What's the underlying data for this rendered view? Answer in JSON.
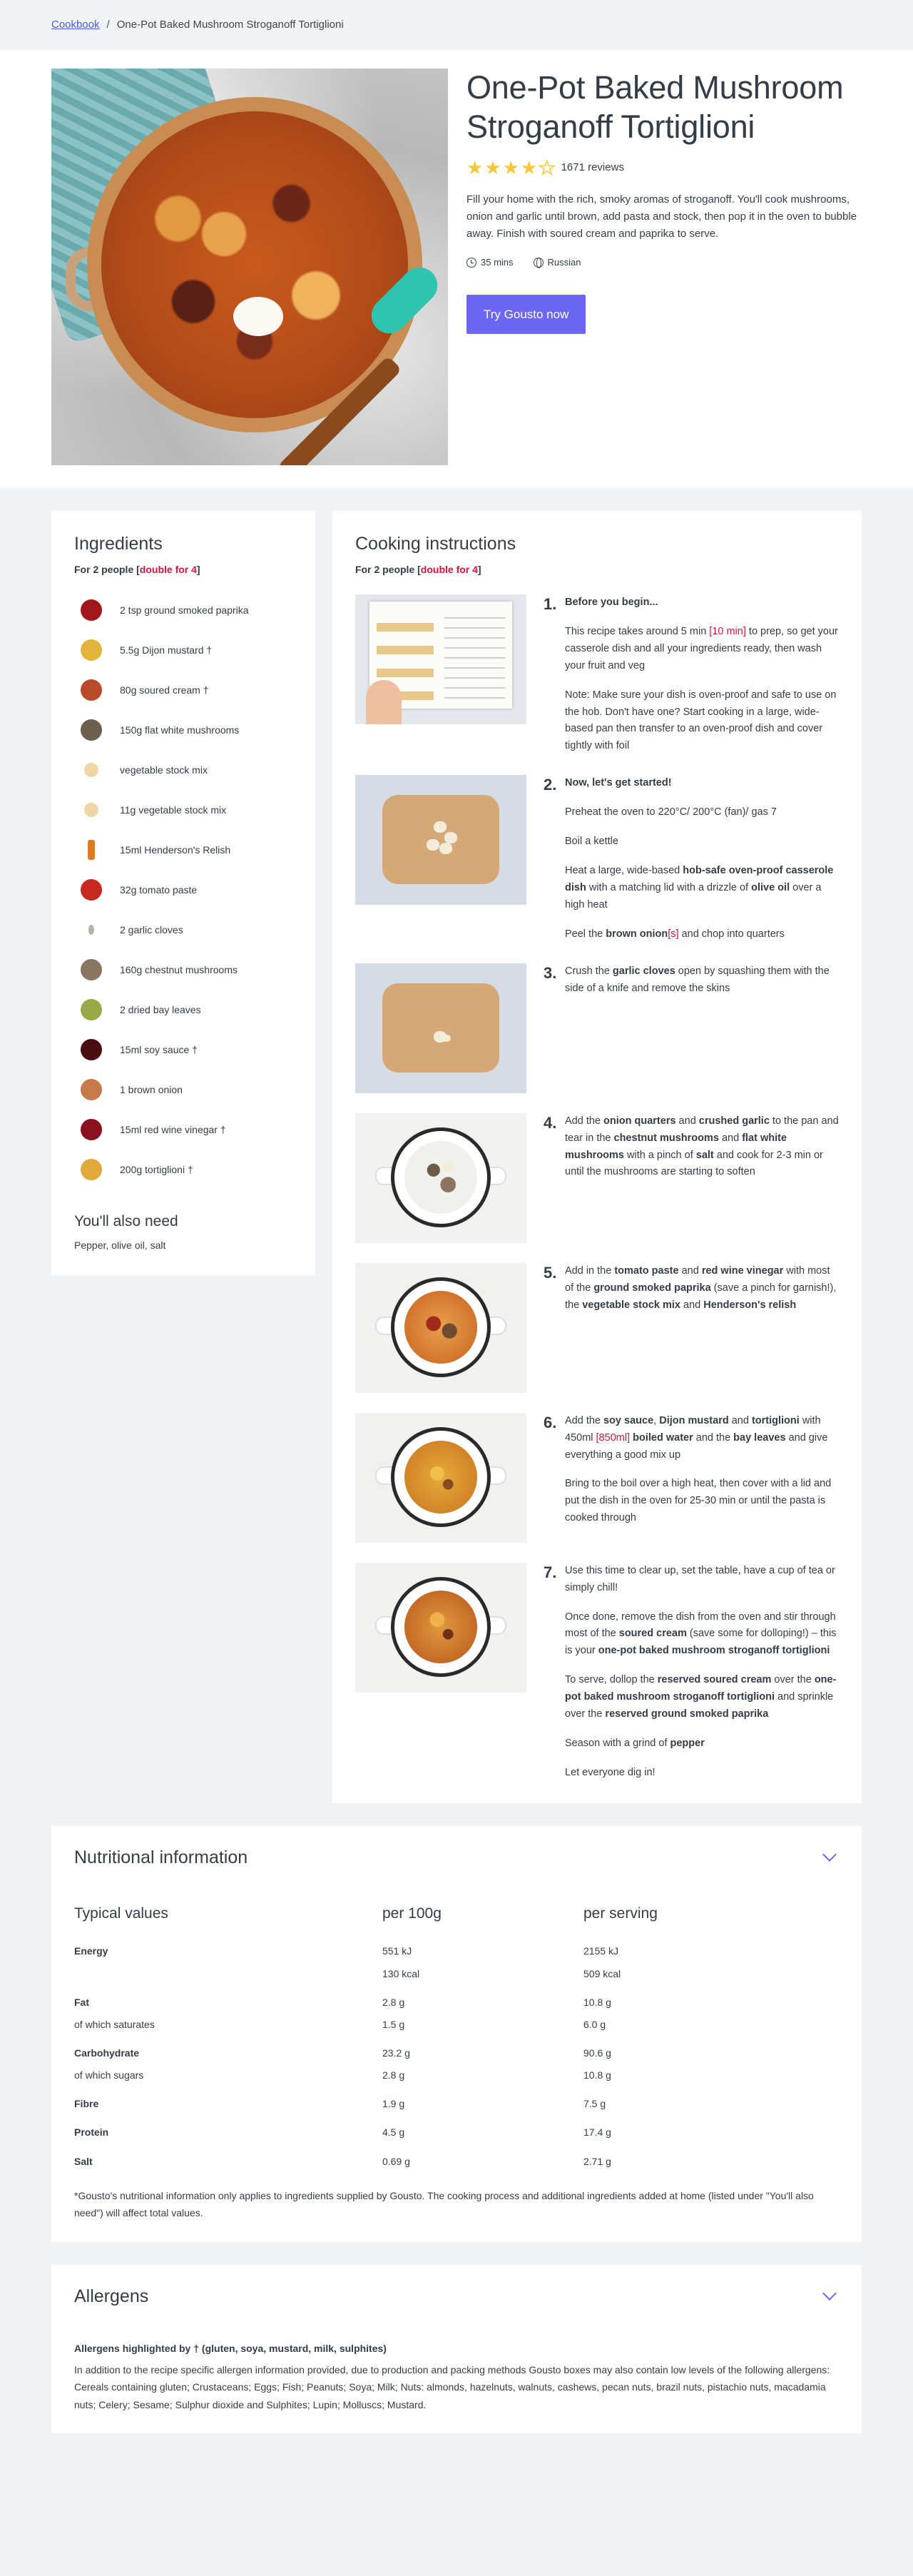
{
  "breadcrumb": {
    "root": "Cookbook",
    "separator": "/",
    "current": "One-Pot Baked Mushroom Stroganoff Tortiglioni"
  },
  "hero": {
    "title": "One-Pot Baked Mushroom Stroganoff Tortiglioni",
    "rating_stars": 4,
    "rating_max": 5,
    "review_count": "1671 reviews",
    "description": "Fill your home with the rich, smoky aromas of stroganoff. You'll cook mushrooms, onion and garlic until brown, add pasta and stock, then pop it in the oven to bubble away. Finish with soured cream and paprika to serve.",
    "time": "35 mins",
    "cuisine": "Russian",
    "cta_label": "Try Gousto now"
  },
  "ingredients": {
    "title": "Ingredients",
    "people_prefix": "For 2 people [",
    "people_link": "double for 4",
    "people_suffix": "]",
    "items": [
      {
        "label": "2 tsp ground smoked paprika",
        "icon": "paprika-icon",
        "color": "#a3171a"
      },
      {
        "label": "5.5g Dijon mustard †",
        "icon": "mustard-icon",
        "color": "#e2b43c"
      },
      {
        "label": "80g soured cream †",
        "icon": "soured-cream-icon",
        "color": "#b84a2a"
      },
      {
        "label": "150g flat white mushrooms",
        "icon": "mushroom-icon",
        "color": "#6e5e4e"
      },
      {
        "label": "vegetable stock mix",
        "icon": "stock-icon",
        "color": "#f2d7a6"
      },
      {
        "label": "11g vegetable stock mix",
        "icon": "stock-icon",
        "color": "#f2d7a6"
      },
      {
        "label": "15ml Henderson's Relish",
        "icon": "relish-bottle-icon",
        "color": "#e07a1c"
      },
      {
        "label": "32g tomato paste",
        "icon": "tomato-paste-icon",
        "color": "#c8281e"
      },
      {
        "label": "2 garlic cloves",
        "icon": "garlic-icon",
        "color": "#b8b0a0"
      },
      {
        "label": "160g chestnut mushrooms",
        "icon": "chestnut-mushroom-icon",
        "color": "#8a7462"
      },
      {
        "label": "2 dried bay leaves",
        "icon": "bay-leaf-icon",
        "color": "#9aa84a"
      },
      {
        "label": "15ml soy sauce †",
        "icon": "soy-sauce-icon",
        "color": "#4a0e10"
      },
      {
        "label": "1 brown onion",
        "icon": "onion-icon",
        "color": "#c87a4a"
      },
      {
        "label": "15ml red wine vinegar †",
        "icon": "vinegar-icon",
        "color": "#8a1020"
      },
      {
        "label": "200g tortiglioni †",
        "icon": "pasta-icon",
        "color": "#e3a83c"
      }
    ],
    "also_title": "You'll also need",
    "also_text": "Pepper, olive oil, salt"
  },
  "instructions": {
    "title": "Cooking instructions",
    "people_prefix": "For 2 people [",
    "people_link": "double for 4",
    "people_suffix": "]",
    "steps": [
      {
        "num": "1.",
        "paragraphs": [
          [
            {
              "t": "Before you begin...",
              "b": true
            }
          ],
          [
            {
              "t": "This recipe takes around 5 min "
            },
            {
              "t": "[10 min]",
              "r": true
            },
            {
              "t": " to prep, so get your casserole dish and all your ingredients ready, then wash your fruit and veg"
            }
          ],
          [
            {
              "t": "Note: Make sure your dish is oven-proof and safe to use on the hob. Don't have one? Start cooking in a large, wide-based pan then transfer to an oven-proof dish and cover tightly with foil"
            }
          ]
        ]
      },
      {
        "num": "2.",
        "paragraphs": [
          [
            {
              "t": "Now, let's get started!",
              "b": true
            }
          ],
          [
            {
              "t": "Preheat the oven to 220°C/ 200°C (fan)/ gas 7"
            }
          ],
          [
            {
              "t": "Boil a kettle"
            }
          ],
          [
            {
              "t": "Heat a large, wide-based "
            },
            {
              "t": "hob-safe oven-proof casserole dish",
              "b": true
            },
            {
              "t": " with a matching lid with a drizzle of "
            },
            {
              "t": "olive oil",
              "b": true
            },
            {
              "t": " over a high heat"
            }
          ],
          [
            {
              "t": "Peel the "
            },
            {
              "t": "brown onion",
              "b": true
            },
            {
              "t": "[s]",
              "r": true
            },
            {
              "t": " and chop into quarters"
            }
          ]
        ]
      },
      {
        "num": "3.",
        "paragraphs": [
          [
            {
              "t": "Crush the "
            },
            {
              "t": "garlic cloves",
              "b": true
            },
            {
              "t": " open by squashing them with the side of a knife and remove the skins"
            }
          ]
        ]
      },
      {
        "num": "4.",
        "paragraphs": [
          [
            {
              "t": "Add the "
            },
            {
              "t": "onion quarters",
              "b": true
            },
            {
              "t": " and "
            },
            {
              "t": "crushed garlic",
              "b": true
            },
            {
              "t": " to the pan and tear in the "
            },
            {
              "t": "chestnut mushrooms",
              "b": true
            },
            {
              "t": " and "
            },
            {
              "t": "flat white mushrooms",
              "b": true
            },
            {
              "t": " with a pinch of "
            },
            {
              "t": "salt",
              "b": true
            },
            {
              "t": " and cook for 2-3 min or until the mushrooms are starting to soften"
            }
          ]
        ]
      },
      {
        "num": "5.",
        "paragraphs": [
          [
            {
              "t": "Add in the "
            },
            {
              "t": "tomato paste",
              "b": true
            },
            {
              "t": " and "
            },
            {
              "t": "red wine vinegar",
              "b": true
            },
            {
              "t": " with most of the "
            },
            {
              "t": "ground smoked paprika",
              "b": true
            },
            {
              "t": " (save a pinch for garnish!), the "
            },
            {
              "t": "vegetable stock mix",
              "b": true
            },
            {
              "t": " and "
            },
            {
              "t": "Henderson's relish",
              "b": true
            }
          ]
        ]
      },
      {
        "num": "6.",
        "paragraphs": [
          [
            {
              "t": "Add the "
            },
            {
              "t": "soy sauce",
              "b": true
            },
            {
              "t": ", "
            },
            {
              "t": "Dijon mustard",
              "b": true
            },
            {
              "t": " and "
            },
            {
              "t": "tortiglioni",
              "b": true
            },
            {
              "t": " with 450ml "
            },
            {
              "t": "[850ml]",
              "r": true
            },
            {
              "t": " "
            },
            {
              "t": "boiled water",
              "b": true
            },
            {
              "t": " and the "
            },
            {
              "t": "bay leaves",
              "b": true
            },
            {
              "t": " and give everything a good mix up"
            }
          ],
          [
            {
              "t": "Bring to the boil over a high heat, then cover with a lid and put the dish in the oven for 25-30 min or until the pasta is cooked through"
            }
          ]
        ]
      },
      {
        "num": "7.",
        "paragraphs": [
          [
            {
              "t": "Use this time to clear up, set the table, have a cup of tea or simply chill!"
            }
          ],
          [
            {
              "t": "Once done, remove the dish from the oven and stir through most of the "
            },
            {
              "t": "soured cream",
              "b": true
            },
            {
              "t": " (save some for dolloping!) – this is your "
            },
            {
              "t": "one-pot baked mushroom stroganoff tortiglioni",
              "b": true
            }
          ],
          [
            {
              "t": "To serve, dollop the "
            },
            {
              "t": "reserved soured cream",
              "b": true
            },
            {
              "t": " over the "
            },
            {
              "t": "one-pot baked mushroom stroganoff tortiglioni",
              "b": true
            },
            {
              "t": " and sprinkle over the "
            },
            {
              "t": "reserved ground smoked paprika",
              "b": true
            }
          ],
          [
            {
              "t": "Season with a grind of "
            },
            {
              "t": "pepper",
              "b": true
            }
          ],
          [
            {
              "t": "Let everyone dig in!"
            }
          ]
        ]
      }
    ]
  },
  "nutrition": {
    "title": "Nutritional information",
    "headers": [
      "Typical values",
      "per 100g",
      "per serving"
    ],
    "rows": [
      {
        "label": "Energy",
        "bold": true,
        "per100": "551 kJ",
        "serving": "2155 kJ"
      },
      {
        "label": "",
        "bold": false,
        "per100": "130 kcal",
        "serving": "509 kcal"
      },
      {
        "label": "Fat",
        "bold": true,
        "per100": "2.8 g",
        "serving": "10.8 g"
      },
      {
        "label": "of which saturates",
        "bold": false,
        "per100": "1.5 g",
        "serving": "6.0 g"
      },
      {
        "label": "Carbohydrate",
        "bold": true,
        "per100": "23.2 g",
        "serving": "90.6 g"
      },
      {
        "label": "of which sugars",
        "bold": false,
        "per100": "2.8 g",
        "serving": "10.8 g"
      },
      {
        "label": "Fibre",
        "bold": true,
        "per100": "1.9 g",
        "serving": "7.5 g"
      },
      {
        "label": "Protein",
        "bold": true,
        "per100": "4.5 g",
        "serving": "17.4 g"
      },
      {
        "label": "Salt",
        "bold": true,
        "per100": "0.69 g",
        "serving": "2.71 g"
      }
    ],
    "footnote": "*Gousto's nutritional information only applies to ingredients supplied by Gousto. The cooking process and additional ingredients added at home (listed under \"You'll also need\") will affect total values."
  },
  "allergens": {
    "title": "Allergens",
    "highlight": "Allergens highlighted by † (gluten, soya, mustard, milk, sulphites)",
    "text": "In addition to the recipe specific allergen information provided, due to production and packing methods Gousto boxes may also contain low levels of the following allergens: Cereals containing gluten; Crustaceans; Eggs; Fish; Peanuts; Soya; Milk; Nuts: almonds, hazelnuts, walnuts, cashews, pecan nuts, brazil nuts, pistachio nuts, macadamia nuts; Celery; Sesame; Sulphur dioxide and Sulphites; Lupin; Molluscs; Mustard."
  }
}
